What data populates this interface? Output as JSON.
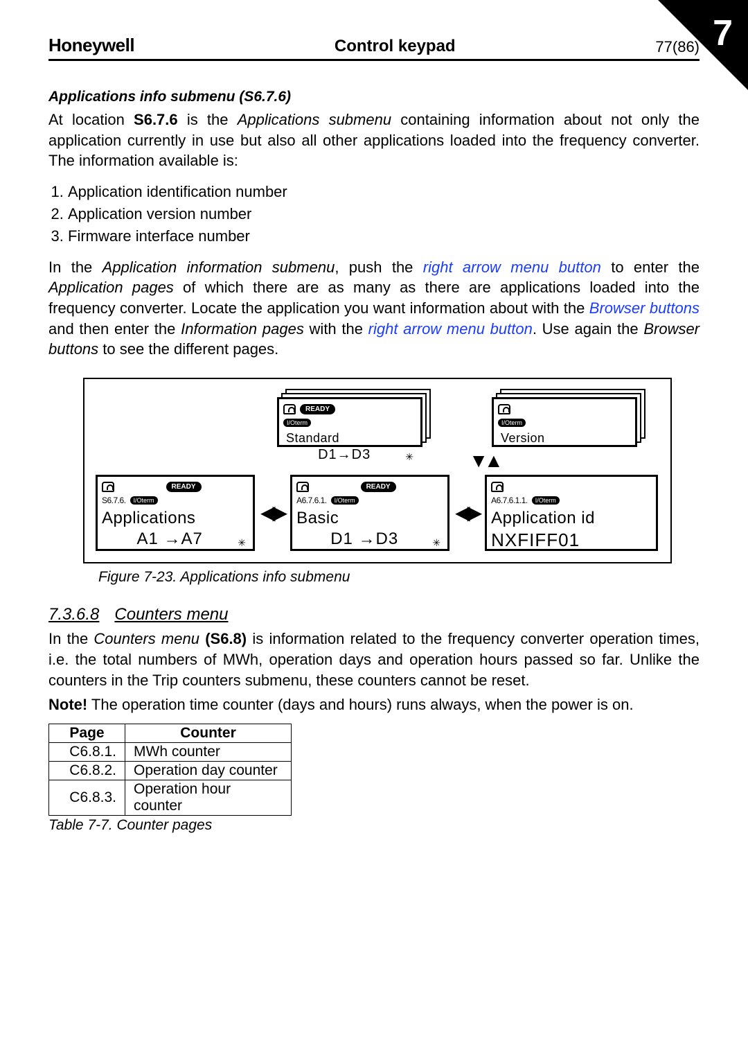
{
  "corner_num": "7",
  "header": {
    "brand": "Honeywell",
    "title": "Control keypad",
    "page": "77(86)"
  },
  "section1": {
    "heading": "Applications info submenu (S6.7.6)",
    "p1_a": "At location ",
    "p1_b": "S6.7.6",
    "p1_c": " is the ",
    "p1_d": "Applications submenu",
    "p1_e": " containing information about not only the application currently in use but also all other applications loaded into the frequency converter. The information available is:",
    "list": [
      "Application identification number",
      "Application version number",
      "Firmware interface number"
    ],
    "p2_a": "In the ",
    "p2_b": "Application information submenu",
    "p2_c": ", push the ",
    "p2_d": "right arrow menu button",
    "p2_e": " to enter the ",
    "p2_f": "Application pages",
    "p2_g": " of which there are as many as there are applications loaded into the frequency converter. Locate the application you want information about with the ",
    "p2_h": "Browser buttons",
    "p2_i": " and then enter the ",
    "p2_j": "Information pages",
    "p2_k": " with the ",
    "p2_l": "right arrow menu button",
    "p2_m": ". Use again the ",
    "p2_n": "Browser buttons",
    "p2_o": " to see the different pages."
  },
  "diagram": {
    "ready": "READY",
    "ioterm": "I/Oterm",
    "top_left": {
      "line1": "Standard",
      "range": "D1→D3"
    },
    "top_right": {
      "line1": "Version"
    },
    "bot1": {
      "code": "S6.7.6.",
      "line1": "Applications",
      "range": "A1 →A7"
    },
    "bot2": {
      "code": "A6.7.6.1.",
      "line1": "Basic",
      "range": "D1 →D3"
    },
    "bot3": {
      "code": "A6.7.6.1.1.",
      "line1": "Application id",
      "line2": "NXFIFF01"
    }
  },
  "figcap": "Figure 7-23. Applications info submenu",
  "section2": {
    "num": "7.3.6.8",
    "title": "Counters menu",
    "p1_a": "In the ",
    "p1_b": "Counters menu",
    "p1_c": " (S6.8)",
    "p1_d": " is information related to the frequency converter operation times, i.e. the total numbers of MWh, operation days and operation hours passed so far. Unlike the counters in the Trip counters submenu, these counters cannot be reset.",
    "note_a": "Note!",
    "note_b": " The operation time counter (days and hours) runs always, when the power is on."
  },
  "table": {
    "h1": "Page",
    "h2": "Counter",
    "rows": [
      {
        "page": "C6.8.1.",
        "counter": "MWh counter"
      },
      {
        "page": "C6.8.2.",
        "counter": "Operation day counter"
      },
      {
        "page": "C6.8.3.",
        "counter": "Operation hour counter"
      }
    ],
    "caption": "Table 7-7. Counter pages"
  }
}
